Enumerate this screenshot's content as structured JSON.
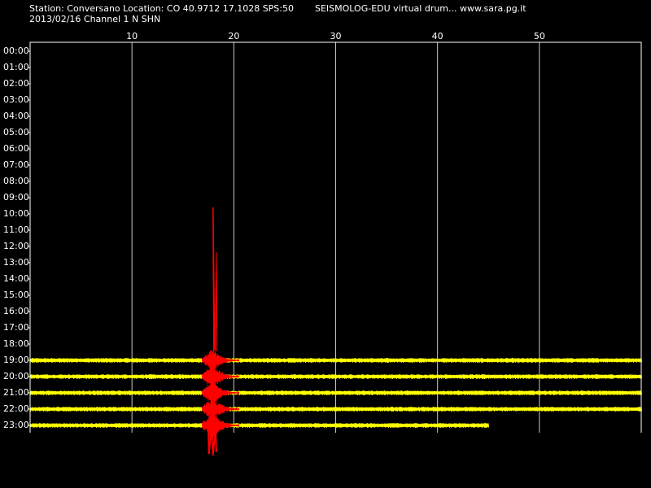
{
  "header": {
    "station_line": "Station: Conversano Location: CO 40.9712 17.1028 SPS:50",
    "date_line": "2013/02/16  Channel 1 N SHN",
    "title": "SEISMOLOG-EDU virtual drum... www.sara.pg.it"
  },
  "colors": {
    "background": "#000000",
    "frame": "#ffffff",
    "grid": "#c8c8c8",
    "trace": "#ffff00",
    "event": "#ff0000",
    "text": "#ffffff"
  },
  "drum": {
    "minute_ticks": [
      "10",
      "20",
      "30",
      "40",
      "50"
    ],
    "minute_range": [
      0,
      60
    ],
    "hour_labels": [
      "00:00",
      "01:00",
      "02:00",
      "03:00",
      "04:00",
      "05:00",
      "06:00",
      "07:00",
      "08:00",
      "09:00",
      "10:00",
      "11:00",
      "12:00",
      "13:00",
      "14:00",
      "15:00",
      "16:00",
      "17:00",
      "18:00",
      "19:00",
      "20:00",
      "21:00",
      "22:00",
      "23:00"
    ],
    "traces": [
      {
        "hour": "19:00",
        "end_minute": 60
      },
      {
        "hour": "20:00",
        "end_minute": 60
      },
      {
        "hour": "21:00",
        "end_minute": 60
      },
      {
        "hour": "22:00",
        "end_minute": 60
      },
      {
        "hour": "23:00",
        "end_minute": 45
      }
    ],
    "event": {
      "start_minute": 16.9,
      "peak_minute": 17.8,
      "end_minute": 20.5
    }
  }
}
